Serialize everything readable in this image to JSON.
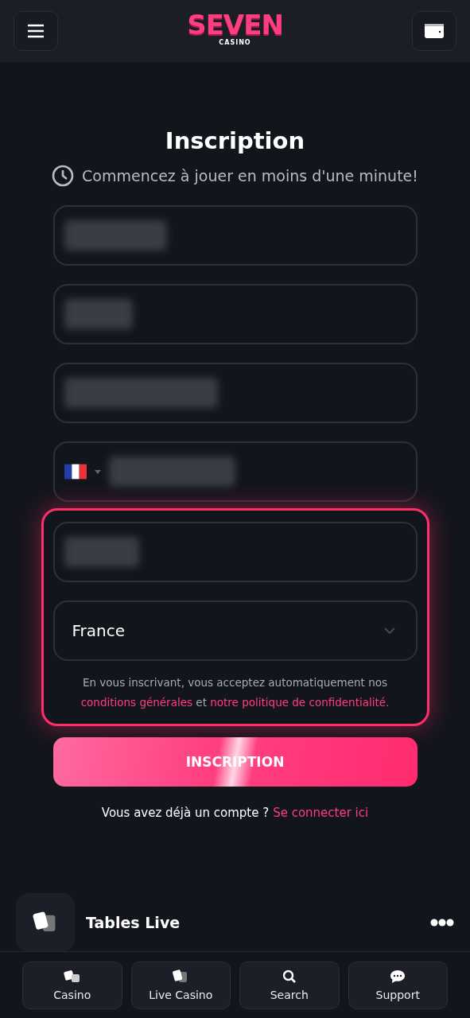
{
  "header": {
    "logo": {
      "title": "SEVEN",
      "subtitle": "CASINO"
    }
  },
  "form": {
    "title": "Inscription",
    "subtitle": "Commencez à jouer en moins d'une minute!",
    "fields": [
      {
        "kind": "blurred"
      },
      {
        "kind": "blurred"
      },
      {
        "kind": "blurred"
      },
      {
        "kind": "phone"
      }
    ],
    "highlighted_fields": [
      {
        "kind": "blurred"
      },
      {
        "kind": "select",
        "value": "France"
      }
    ],
    "terms": "En vous inscrivant, vous acceptez automatiquement nos",
    "terms_link_1": "conditions générales",
    "terms_joiner": "et",
    "terms_link_2": "notre politique de confidentialité.",
    "submit": "INSCRIPTION",
    "login_prompt": "Vous avez déjà un compte ?",
    "login_link": "Se connecter ici"
  },
  "section": {
    "title": "Tables Live"
  },
  "bottom_nav": [
    {
      "kind": "casino",
      "label": "Casino"
    },
    {
      "kind": "live",
      "label": "Live Casino"
    },
    {
      "kind": "search",
      "label": "Search"
    },
    {
      "kind": "support",
      "label": "Support"
    }
  ]
}
